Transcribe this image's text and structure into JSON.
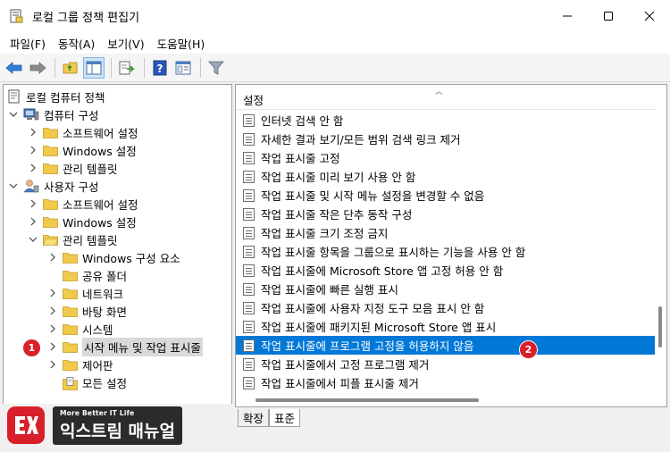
{
  "window": {
    "title": "로컬 그룹 정책 편집기"
  },
  "menu": [
    "파일(F)",
    "동작(A)",
    "보기(V)",
    "도움말(H)"
  ],
  "tree": {
    "root": "로컬 컴퓨터 정책",
    "items": [
      "컴퓨터 구성",
      "소프트웨어 설정",
      "Windows 설정",
      "관리 템플릿",
      "사용자 구성",
      "소프트웨어 설정",
      "Windows 설정",
      "관리 템플릿",
      "Windows 구성 요소",
      "공유 폴더",
      "네트워크",
      "바탕 화면",
      "시스템",
      "시작 메뉴 및 작업 표시줄",
      "제어판",
      "모든 설정"
    ]
  },
  "list": {
    "header": "설정",
    "items": [
      "인터넷 검색 안 함",
      "자세한 결과 보기/모든 범위 검색 링크 제거",
      "작업 표시줄 고정",
      "작업 표시줄 미리 보기 사용 안 함",
      "작업 표시줄 및 시작 메뉴 설정을 변경할 수 없음",
      "작업 표시줄 작은 단추 동작 구성",
      "작업 표시줄 크기 조정 금지",
      "작업 표시줄 항목을 그룹으로 표시하는 기능을 사용 안 함",
      "작업 표시줄에 Microsoft Store 앱 고정 허용 안 함",
      "작업 표시줄에 빠른 실행 표시",
      "작업 표시줄에 사용자 지정 도구 모음 표시 안 함",
      "작업 표시줄에 패키지된 Microsoft Store 앱 표시",
      "작업 표시줄에 프로그램 고정을 허용하지 않음",
      "작업 표시줄에서 고정 프로그램 제거",
      "작업 표시줄에서 피플 표시줄 제거"
    ]
  },
  "tabs": [
    "확장",
    "표준"
  ],
  "badges": [
    "1",
    "2"
  ],
  "brand": {
    "tagline": "More Better IT Life",
    "name": "익스트림 매뉴얼"
  },
  "colors": {
    "selection": "#0078d7",
    "badge": "#d91f2a",
    "folder": "#f1c94b"
  }
}
